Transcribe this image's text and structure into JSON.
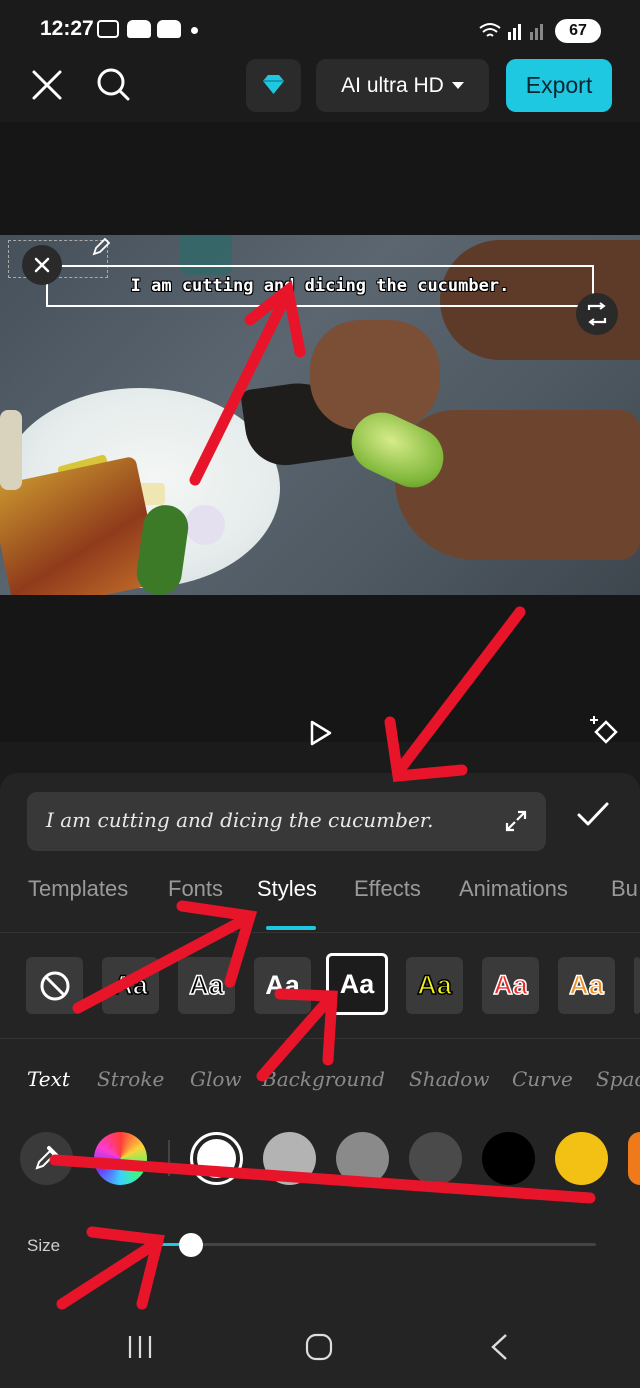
{
  "status_bar": {
    "time": "12:27",
    "battery": "67"
  },
  "toolbar": {
    "quality_label": "AI ultra HD",
    "export_label": "Export"
  },
  "preview": {
    "caption": "I am cutting and dicing the cucumber."
  },
  "editor": {
    "text_value": "I am cutting and dicing the cucumber.",
    "tabs": [
      "Templates",
      "Fonts",
      "Styles",
      "Effects",
      "Animations",
      "Bu"
    ],
    "active_tab": "Styles",
    "style_presets": [
      "Aa",
      "Aa",
      "Aa",
      "Aa",
      "Aa",
      "Aa",
      "Aa"
    ],
    "subtabs": [
      "Text",
      "Stroke",
      "Glow",
      "Background",
      "Shadow",
      "Curve",
      "Spac"
    ],
    "active_subtab": "Text",
    "swatches": [
      "#ffffff",
      "#b3b3b3",
      "#8a8a8a",
      "#4a4a4a",
      "#000000",
      "#f3c114",
      "#f07a1a"
    ],
    "selected_swatch": "#ffffff",
    "size_label": "Size",
    "size_value": 0.07
  },
  "colors": {
    "accent": "#1ec8e0",
    "annotation": "#e8152a"
  }
}
